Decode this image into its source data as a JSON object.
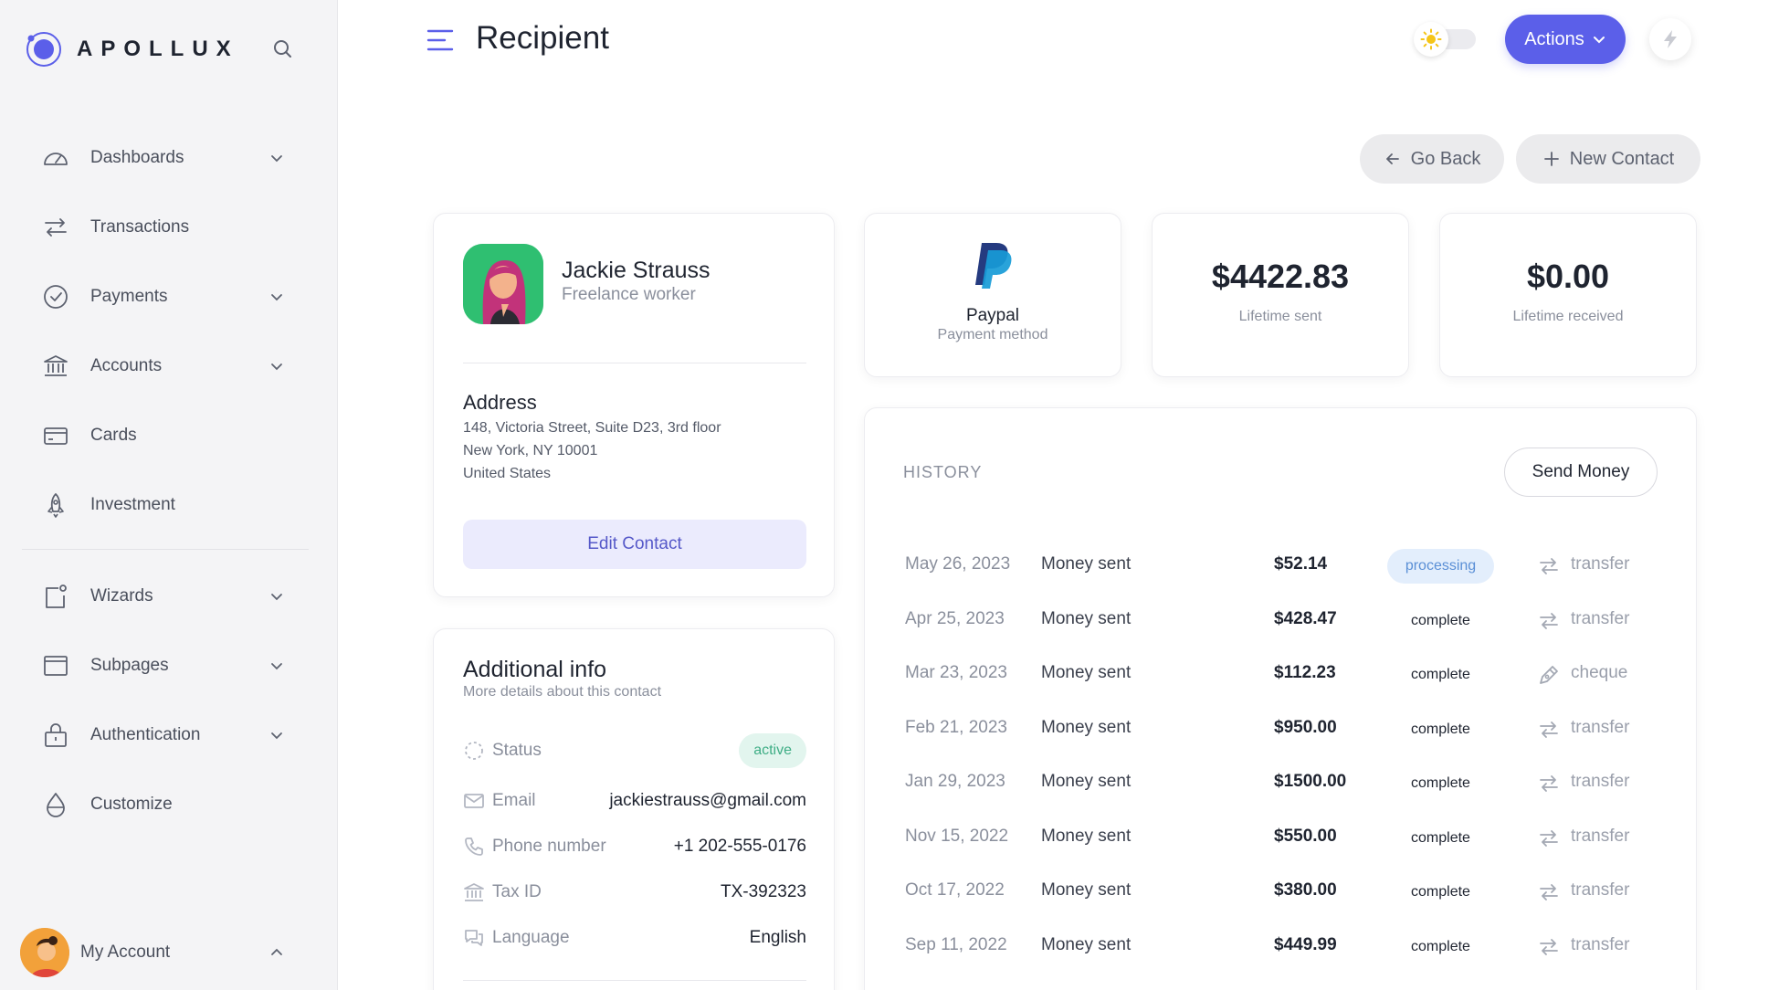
{
  "brand": {
    "name": "APOLLUX",
    "accent": "#5b5fe9"
  },
  "sidebar": {
    "items": [
      {
        "label": "Dashboards",
        "icon": "gauge-icon",
        "has_chevron": true
      },
      {
        "label": "Transactions",
        "icon": "arrows-swap-icon",
        "has_chevron": false
      },
      {
        "label": "Payments",
        "icon": "check-circle-icon",
        "has_chevron": true
      },
      {
        "label": "Accounts",
        "icon": "bank-icon",
        "has_chevron": true
      },
      {
        "label": "Cards",
        "icon": "credit-card-icon",
        "has_chevron": false
      },
      {
        "label": "Investment",
        "icon": "rocket-icon",
        "has_chevron": false
      },
      {
        "label": "Wizards",
        "icon": "wizard-icon",
        "has_chevron": true
      },
      {
        "label": "Subpages",
        "icon": "window-icon",
        "has_chevron": true
      },
      {
        "label": "Authentication",
        "icon": "lock-icon",
        "has_chevron": true
      },
      {
        "label": "Customize",
        "icon": "droplet-icon",
        "has_chevron": false
      }
    ],
    "account_label": "My Account"
  },
  "header": {
    "title": "Recipient",
    "actions_label": "Actions"
  },
  "buttons": {
    "go_back": "Go Back",
    "new_contact": "New Contact",
    "edit_contact": "Edit Contact",
    "send_money": "Send Money"
  },
  "profile": {
    "name": "Jackie Strauss",
    "role": "Freelance worker",
    "address_title": "Address",
    "address_lines": [
      "148, Victoria Street, Suite D23, 3rd floor",
      "New York, NY 10001",
      "United States"
    ]
  },
  "additional": {
    "title": "Additional info",
    "subtitle": "More details about this contact",
    "rows": [
      {
        "label": "Status",
        "value": "active",
        "icon": "status-dashed-circle-icon"
      },
      {
        "label": "Email",
        "value": "jackiestrauss@gmail.com",
        "icon": "mail-icon"
      },
      {
        "label": "Phone number",
        "value": "+1 202-555-0176",
        "icon": "phone-icon"
      },
      {
        "label": "Tax ID",
        "value": "TX-392323",
        "icon": "bank-icon"
      },
      {
        "label": "Language",
        "value": "English",
        "icon": "chat-bubbles-icon"
      }
    ]
  },
  "stats": {
    "payment_method_name": "Paypal",
    "payment_method_label": "Payment method",
    "lifetime_sent_value": "$4422.83",
    "lifetime_sent_label": "Lifetime sent",
    "lifetime_received_value": "$0.00",
    "lifetime_received_label": "Lifetime received"
  },
  "history": {
    "title": "HISTORY",
    "rows": [
      {
        "date": "May 26, 2023",
        "desc": "Money sent",
        "amount": "$52.14",
        "status": "processing",
        "method": "transfer",
        "method_icon": "arrows-swap-icon"
      },
      {
        "date": "Apr 25, 2023",
        "desc": "Money sent",
        "amount": "$428.47",
        "status": "complete",
        "method": "transfer",
        "method_icon": "arrows-swap-icon"
      },
      {
        "date": "Mar 23, 2023",
        "desc": "Money sent",
        "amount": "$112.23",
        "status": "complete",
        "method": "cheque",
        "method_icon": "pen-icon"
      },
      {
        "date": "Feb 21, 2023",
        "desc": "Money sent",
        "amount": "$950.00",
        "status": "complete",
        "method": "transfer",
        "method_icon": "arrows-swap-icon"
      },
      {
        "date": "Jan 29, 2023",
        "desc": "Money sent",
        "amount": "$1500.00",
        "status": "complete",
        "method": "transfer",
        "method_icon": "arrows-swap-icon"
      },
      {
        "date": "Nov 15, 2022",
        "desc": "Money sent",
        "amount": "$550.00",
        "status": "complete",
        "method": "transfer",
        "method_icon": "arrows-swap-icon"
      },
      {
        "date": "Oct 17, 2022",
        "desc": "Money sent",
        "amount": "$380.00",
        "status": "complete",
        "method": "transfer",
        "method_icon": "arrows-swap-icon"
      },
      {
        "date": "Sep 11, 2022",
        "desc": "Money sent",
        "amount": "$449.99",
        "status": "complete",
        "method": "transfer",
        "method_icon": "arrows-swap-icon"
      }
    ]
  }
}
